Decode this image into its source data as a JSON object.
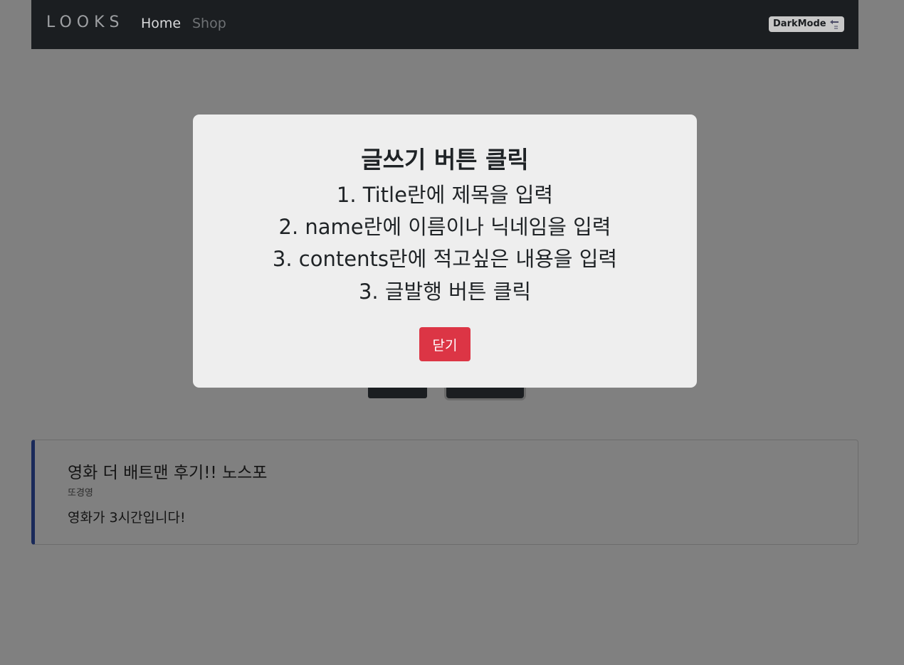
{
  "navbar": {
    "brand": "LOOKS",
    "links": [
      "Home",
      "Shop"
    ],
    "darkmode_label": "DarkMode",
    "darkmode_icon": "swap-arrows-icon"
  },
  "post": {
    "title": "영화 더 배트맨 후기!! 노스포",
    "author": "또경영",
    "body": "영화가 3시간입니다!"
  },
  "modal": {
    "title": "글쓰기 버튼 클릭",
    "steps": [
      "1. Title란에 제목을 입력",
      "2. name란에 이름이나 닉네임을 입력",
      "3. contents란에 적고싶은 내용을 입력",
      "3. 글발행 버튼 클릭"
    ],
    "close_label": "닫기"
  },
  "colors": {
    "navbar_bg": "#1b1e21",
    "overlay": "#808080",
    "modal_bg": "#eeeeee",
    "danger": "#dc3545",
    "card_accent": "#1a2a5a"
  }
}
